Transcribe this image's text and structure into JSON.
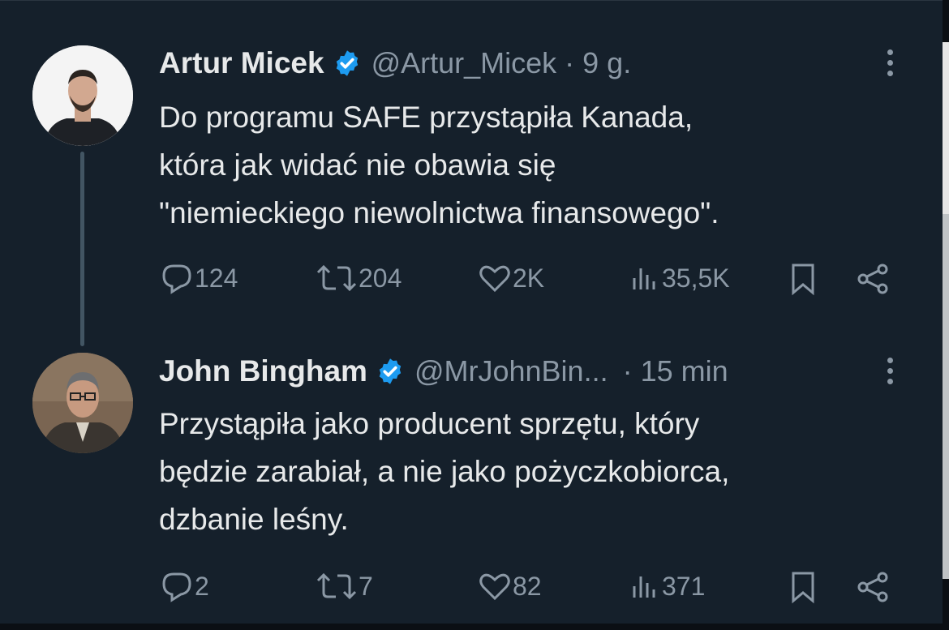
{
  "tweets": [
    {
      "author": "Artur Micek",
      "handle": "@Artur_Micek",
      "time": "· 9 g.",
      "text": "Do programu SAFE przystąpiła Kanada,\nktóra jak widać nie obawia się\n\"niemieckiego niewolnictwa finansowego\".",
      "replies": "124",
      "retweets": "204",
      "likes": "2K",
      "views": "35,5K"
    },
    {
      "author": "John Bingham",
      "handle": "@MrJohnBin...",
      "time": "· 15 min",
      "text": "Przystąpiła jako producent sprzętu, który\nbędzie zarabiał, a nie jako  pożyczkobiorca,\ndzbanie leśny.",
      "replies": "2",
      "retweets": "7",
      "likes": "82",
      "views": "371"
    }
  ],
  "colors": {
    "background": "#15202b",
    "text": "#e7e9ea",
    "muted": "#8b98a5",
    "verified": "#1d9bf0",
    "thread_line": "#425563"
  },
  "icons": [
    "verified-badge-icon",
    "more-icon",
    "reply-icon",
    "retweet-icon",
    "like-icon",
    "views-icon",
    "bookmark-icon",
    "share-icon"
  ]
}
